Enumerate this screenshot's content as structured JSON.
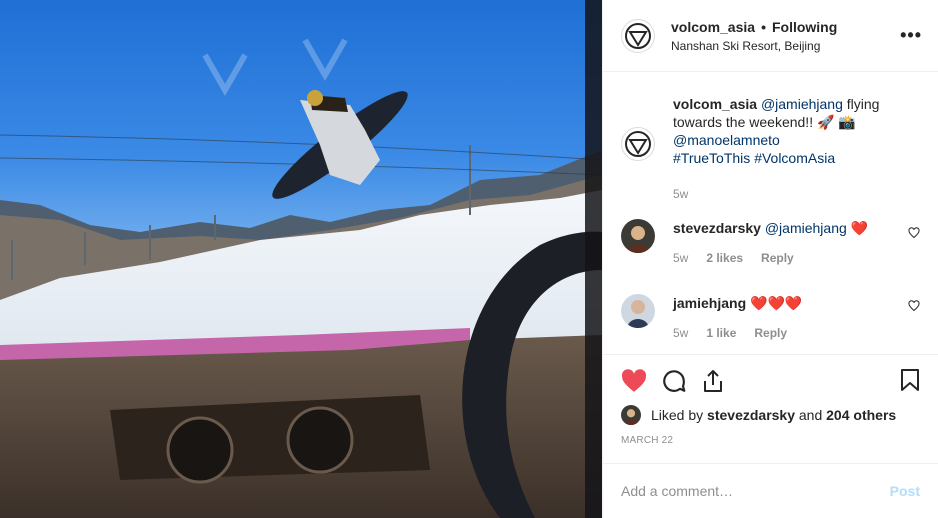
{
  "post": {
    "username": "volcom_asia",
    "follow_separator": "•",
    "follow_status": "Following",
    "location": "Nanshan Ski Resort, Beijing",
    "more_icon": "more-horizontal-icon"
  },
  "caption": {
    "username": "volcom_asia",
    "mention1": "@jamiehjang",
    "text1": " flying towards the weekend!! 🚀 📸",
    "mention2": "@manoelamneto",
    "hashtag1": "#TrueToThis",
    "hashtag2": "#VolcomAsia",
    "age": "5w"
  },
  "comments": [
    {
      "username": "stevezdarsky",
      "mention": "@jamiehjang",
      "text": " ❤️",
      "age": "5w",
      "likes": "2 likes",
      "reply": "Reply"
    },
    {
      "username": "jamiehjang",
      "text": "❤️❤️❤️",
      "age": "5w",
      "likes": "1 like",
      "reply": "Reply"
    }
  ],
  "likes": {
    "prefix": "Liked by",
    "user": "stevezdarsky",
    "mid": "and",
    "others": "204 others"
  },
  "date": "MARCH 22",
  "comment_box": {
    "placeholder": "Add a comment…",
    "post_label": "Post"
  },
  "colors": {
    "like_red": "#ed4956",
    "link_blue": "#003569",
    "post_disabled": "#b2dffc"
  }
}
